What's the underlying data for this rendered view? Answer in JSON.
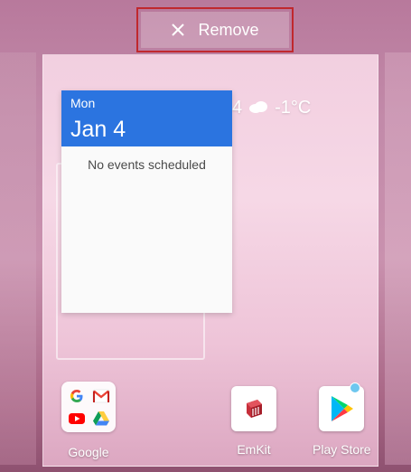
{
  "drop_target": {
    "label": "Remove",
    "icon": "close-icon",
    "highlight_color": "#c0282e"
  },
  "weather": {
    "partial_text": "4",
    "icon": "cloud-icon",
    "temperature": "-1°C"
  },
  "calendar_widget": {
    "day": "Mon",
    "date": "Jan 4",
    "empty_message": "No events scheduled",
    "header_color": "#2b74e0"
  },
  "apps": [
    {
      "label": "Google",
      "icon": "google-folder-icon"
    },
    {
      "label": "EmKit",
      "icon": "emkit-icon"
    },
    {
      "label": "Play Store",
      "icon": "play-store-icon"
    }
  ]
}
